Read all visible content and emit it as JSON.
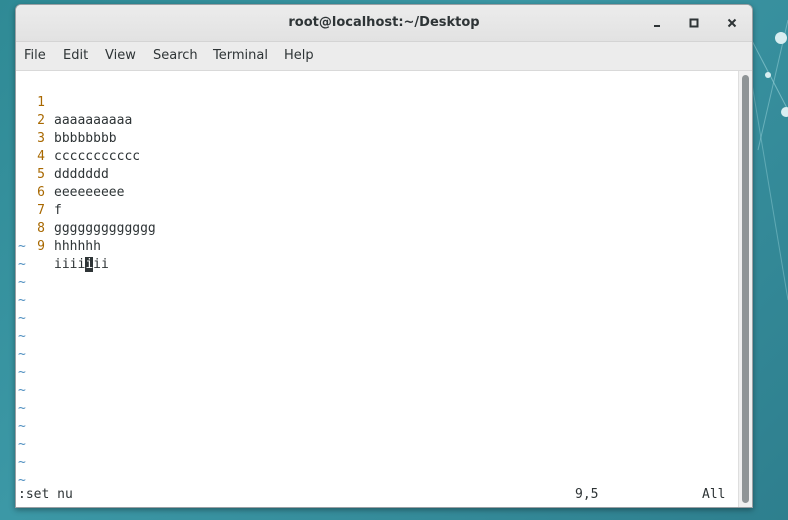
{
  "window": {
    "title": "root@localhost:~/Desktop"
  },
  "menu": {
    "items": [
      "File",
      "Edit",
      "View",
      "Search",
      "Terminal",
      "Help"
    ]
  },
  "editor": {
    "lines": [
      {
        "num": "1",
        "text": "aaaaaaaaaa"
      },
      {
        "num": "2",
        "text": "bbbbbbbb"
      },
      {
        "num": "3",
        "text": "ccccccccccc"
      },
      {
        "num": "4",
        "text": "ddddddd"
      },
      {
        "num": "5",
        "text": "eeeeeeeee"
      },
      {
        "num": "6",
        "text": "f"
      },
      {
        "num": "7",
        "text": "ggggggggggggg"
      },
      {
        "num": "8",
        "text": "hhhhhh"
      },
      {
        "num": "9",
        "text_before": "iiii",
        "cursor_char": "i",
        "text_after": "ii"
      }
    ],
    "tilde": "~",
    "tilde_count": 14
  },
  "status": {
    "command": ":set nu",
    "position": "9,5",
    "scroll": "All"
  },
  "colors": {
    "line_number": "#a86800",
    "tilde": "#4f8fc0",
    "text": "#2e3436",
    "desktop": "#3c98a6"
  }
}
